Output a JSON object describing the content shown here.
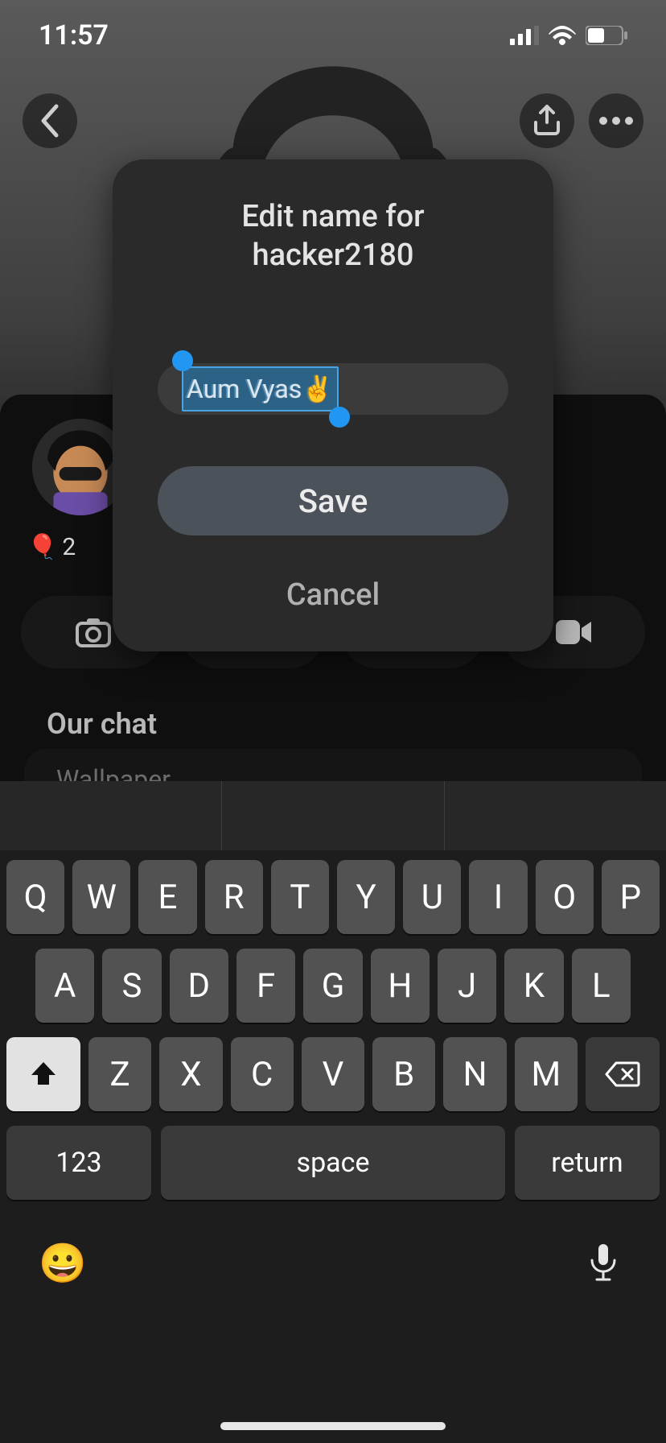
{
  "status": {
    "time": "11:57"
  },
  "modal": {
    "title_prefix": "Edit name for",
    "username": "hacker2180",
    "name_value": "Aum Vyas✌️",
    "save_label": "Save",
    "cancel_label": "Cancel"
  },
  "background": {
    "balloon_count": "2",
    "section_label": "Our chat",
    "sub_row_label": "Wallpaper"
  },
  "keyboard": {
    "row1": [
      "Q",
      "W",
      "E",
      "R",
      "T",
      "Y",
      "U",
      "I",
      "O",
      "P"
    ],
    "row2": [
      "A",
      "S",
      "D",
      "F",
      "G",
      "H",
      "J",
      "K",
      "L"
    ],
    "row3": [
      "Z",
      "X",
      "C",
      "V",
      "B",
      "N",
      "M"
    ],
    "num_label": "123",
    "space_label": "space",
    "return_label": "return"
  },
  "predictions": [
    "",
    "",
    ""
  ]
}
